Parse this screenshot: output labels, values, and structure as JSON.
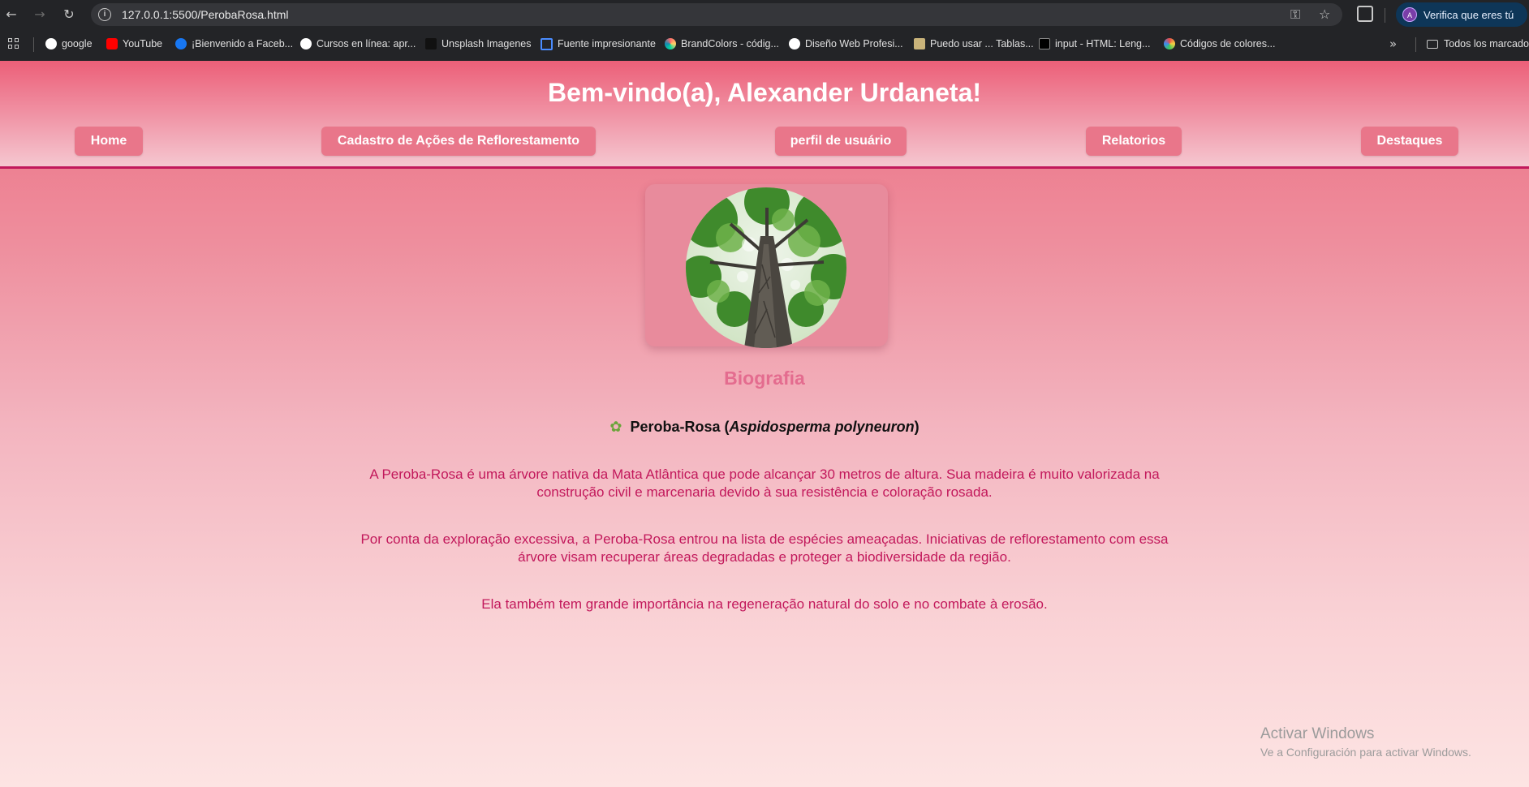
{
  "browser": {
    "url": "127.0.0.1:5500/PerobaRosa.html",
    "profile_label": "Verifica que eres tú",
    "bookmarks": [
      {
        "label": "google",
        "color": "#ffffff"
      },
      {
        "label": "YouTube",
        "color": "#ff0000"
      },
      {
        "label": "¡Bienvenido a Faceb...",
        "color": "#1877f2"
      },
      {
        "label": "Cursos en línea: apr...",
        "color": "#ffffff"
      },
      {
        "label": "Unsplash Imagenes",
        "color": "#111111"
      },
      {
        "label": "Fuente impresionante",
        "color": "#4a8cff"
      },
      {
        "label": "BrandColors - códig...",
        "color": "#ff6b6b"
      },
      {
        "label": "Diseño Web Profesi...",
        "color": "#ffffff"
      },
      {
        "label": "Puedo usar ... Tablas...",
        "color": "#c9b37a"
      },
      {
        "label": "input - HTML: Leng...",
        "color": "#000000"
      },
      {
        "label": "Códigos de colores...",
        "color": "#e84a4a"
      }
    ],
    "all_bookmarks_label": "Todos los marcadores"
  },
  "header": {
    "welcome": "Bem-vindo(a), Alexander Urdaneta!",
    "nav": [
      {
        "label": "Home"
      },
      {
        "label": "Cadastro de Ações de Reflorestamento"
      },
      {
        "label": "perfil de usuário"
      },
      {
        "label": "Relatorios"
      },
      {
        "label": "Destaques"
      }
    ]
  },
  "main": {
    "bio_title": "Biografia",
    "species_name": "Peroba-Rosa (",
    "species_scientific": "Aspidosperma polyneuron",
    "species_close": ")",
    "paragraphs": [
      "A Peroba-Rosa é uma árvore nativa da Mata Atlântica que pode alcançar 30 metros de altura. Sua madeira é muito valorizada na construção civil e marcenaria devido à sua resistência e coloração rosada.",
      "Por conta da exploração excessiva, a Peroba-Rosa entrou na lista de espécies ameaçadas. Iniciativas de reflorestamento com essa árvore visam recuperar áreas degradadas e proteger a biodiversidade da região.",
      "Ela também tem grande importância na regeneração natural do solo e no combate à erosão."
    ]
  },
  "os_watermark": {
    "line1": "Activar Windows",
    "line2": "Ve a Configuración para activar Windows."
  },
  "colors": {
    "accent": "#c2185b",
    "nav_button": "#e9768a",
    "bio_title": "#e46c8f"
  }
}
